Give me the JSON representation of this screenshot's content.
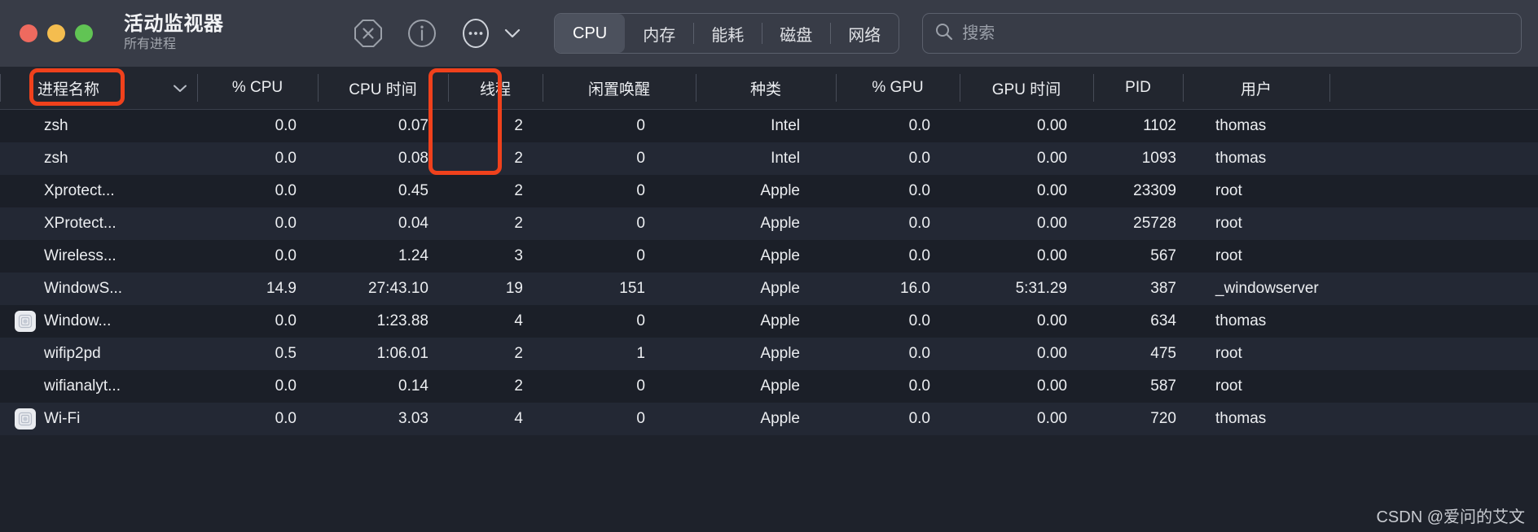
{
  "window": {
    "title": "活动监视器",
    "subtitle": "所有进程",
    "traffic_lights": [
      {
        "name": "close",
        "color": "#ee6a5f"
      },
      {
        "name": "minimize",
        "color": "#f4bd4f"
      },
      {
        "name": "maximize",
        "color": "#61c454"
      }
    ]
  },
  "toolbar": {
    "icons": [
      {
        "name": "stop-process-icon",
        "glyph": "octagon-x"
      },
      {
        "name": "inspect-process-icon",
        "glyph": "circle-i"
      },
      {
        "name": "more-options-icon",
        "glyph": "circle-ellipsis"
      },
      {
        "name": "chevron-down-icon",
        "glyph": "chevron-down"
      }
    ],
    "tabs": [
      {
        "label": "CPU",
        "active": true
      },
      {
        "label": "内存",
        "active": false
      },
      {
        "label": "能耗",
        "active": false
      },
      {
        "label": "磁盘",
        "active": false
      },
      {
        "label": "网络",
        "active": false
      }
    ]
  },
  "search": {
    "placeholder": "搜索",
    "value": "",
    "icon": "search-icon"
  },
  "table": {
    "columns": [
      {
        "key": "name",
        "label": "进程名称"
      },
      {
        "key": "sort",
        "label": ""
      },
      {
        "key": "cpu",
        "label": "% CPU"
      },
      {
        "key": "cputime",
        "label": "CPU 时间"
      },
      {
        "key": "threads",
        "label": "线程"
      },
      {
        "key": "idle",
        "label": "闲置唤醒"
      },
      {
        "key": "kind",
        "label": "种类"
      },
      {
        "key": "gpu",
        "label": "% GPU"
      },
      {
        "key": "gputime",
        "label": "GPU 时间"
      },
      {
        "key": "pid",
        "label": "PID"
      },
      {
        "key": "user",
        "label": "用户"
      }
    ],
    "rows": [
      {
        "icon": false,
        "name": "zsh",
        "cpu": "0.0",
        "cputime": "0.07",
        "threads": "2",
        "idle": "0",
        "kind": "Intel",
        "gpu": "0.0",
        "gputime": "0.00",
        "pid": "1102",
        "user": "thomas"
      },
      {
        "icon": false,
        "name": "zsh",
        "cpu": "0.0",
        "cputime": "0.08",
        "threads": "2",
        "idle": "0",
        "kind": "Intel",
        "gpu": "0.0",
        "gputime": "0.00",
        "pid": "1093",
        "user": "thomas"
      },
      {
        "icon": false,
        "name": "Xprotect...",
        "cpu": "0.0",
        "cputime": "0.45",
        "threads": "2",
        "idle": "0",
        "kind": "Apple",
        "gpu": "0.0",
        "gputime": "0.00",
        "pid": "23309",
        "user": "root"
      },
      {
        "icon": false,
        "name": "XProtect...",
        "cpu": "0.0",
        "cputime": "0.04",
        "threads": "2",
        "idle": "0",
        "kind": "Apple",
        "gpu": "0.0",
        "gputime": "0.00",
        "pid": "25728",
        "user": "root"
      },
      {
        "icon": false,
        "name": "Wireless...",
        "cpu": "0.0",
        "cputime": "1.24",
        "threads": "3",
        "idle": "0",
        "kind": "Apple",
        "gpu": "0.0",
        "gputime": "0.00",
        "pid": "567",
        "user": "root"
      },
      {
        "icon": false,
        "name": "WindowS...",
        "cpu": "14.9",
        "cputime": "27:43.10",
        "threads": "19",
        "idle": "151",
        "kind": "Apple",
        "gpu": "16.0",
        "gputime": "5:31.29",
        "pid": "387",
        "user": "_windowserver"
      },
      {
        "icon": true,
        "name": "Window...",
        "cpu": "0.0",
        "cputime": "1:23.88",
        "threads": "4",
        "idle": "0",
        "kind": "Apple",
        "gpu": "0.0",
        "gputime": "0.00",
        "pid": "634",
        "user": "thomas"
      },
      {
        "icon": false,
        "name": "wifip2pd",
        "cpu": "0.5",
        "cputime": "1:06.01",
        "threads": "2",
        "idle": "1",
        "kind": "Apple",
        "gpu": "0.0",
        "gputime": "0.00",
        "pid": "475",
        "user": "root"
      },
      {
        "icon": false,
        "name": "wifianalyt...",
        "cpu": "0.0",
        "cputime": "0.14",
        "threads": "2",
        "idle": "0",
        "kind": "Apple",
        "gpu": "0.0",
        "gputime": "0.00",
        "pid": "587",
        "user": "root"
      },
      {
        "icon": true,
        "name": "Wi-Fi",
        "cpu": "0.0",
        "cputime": "3.03",
        "threads": "4",
        "idle": "0",
        "kind": "Apple",
        "gpu": "0.0",
        "gputime": "0.00",
        "pid": "720",
        "user": "thomas"
      }
    ]
  },
  "annotations": {
    "highlight_color": "#f0411c",
    "boxes": [
      {
        "name": "process-name-column-highlight",
        "target": "进程名称"
      },
      {
        "name": "threads-column-highlight",
        "target": "线程"
      }
    ]
  },
  "watermark": {
    "text": "CSDN @爱问的艾文"
  }
}
